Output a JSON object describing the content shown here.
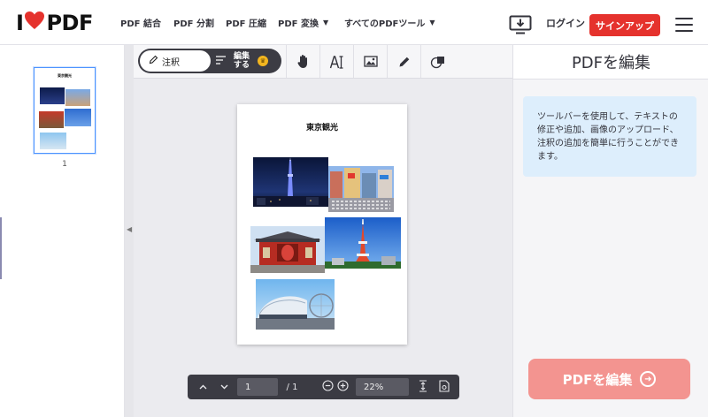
{
  "header": {
    "logo_text": "I♥PDF",
    "nav": [
      {
        "label": "PDF 結合",
        "dropdown": false
      },
      {
        "label": "PDF 分割",
        "dropdown": false
      },
      {
        "label": "PDF 圧縮",
        "dropdown": false
      },
      {
        "label": "PDF 変換",
        "dropdown": true
      },
      {
        "label": "すべてのPDFツール",
        "dropdown": true
      }
    ],
    "login_label": "ログイン",
    "signup_label": "サインアップ",
    "icons": {
      "download": "desktop-download-icon",
      "menu": "hamburger-menu-icon"
    },
    "brand_color": "#e5322d"
  },
  "thumbnails": {
    "page_number": "1"
  },
  "toolbar": {
    "annotate_label": "注釈",
    "edit_label_line1": "編集",
    "edit_label_line2": "する",
    "tools": [
      "hand-icon",
      "text-icon",
      "image-icon",
      "pencil-icon",
      "shape-icon"
    ]
  },
  "document": {
    "title": "東京観光"
  },
  "bottom_bar": {
    "page_value": "1",
    "total_pages": "/ 1",
    "zoom_value": "22%"
  },
  "right_panel": {
    "title": "PDFを編集",
    "info_text": "ツールバーを使用して、テキストの修正や追加、画像のアップロード、注釈の追加を簡単に行うことができます。",
    "cta_label": "PDFを編集"
  }
}
